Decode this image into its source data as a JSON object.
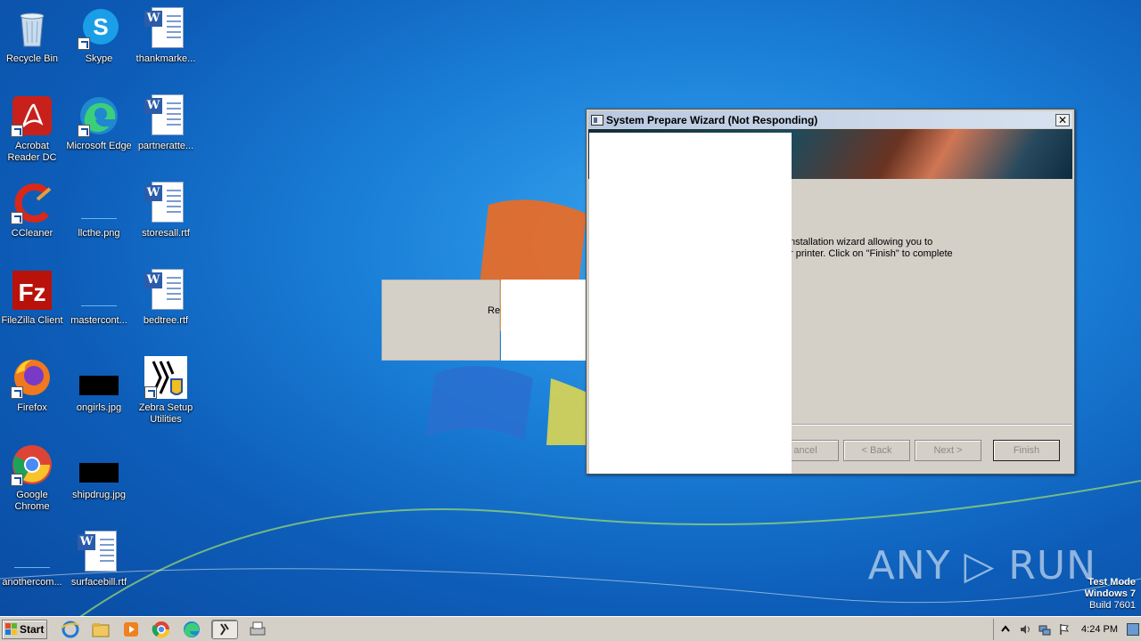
{
  "desktop": {
    "icons": [
      {
        "label": "Recycle Bin"
      },
      {
        "label": "Skype"
      },
      {
        "label": "thankmarke..."
      },
      {
        "label": "Acrobat Reader DC"
      },
      {
        "label": "Microsoft Edge"
      },
      {
        "label": "partneratte..."
      },
      {
        "label": "CCleaner"
      },
      {
        "label": "llcthe.png"
      },
      {
        "label": "storesall.rtf"
      },
      {
        "label": "FileZilla Client"
      },
      {
        "label": "mastercont..."
      },
      {
        "label": "bedtree.rtf"
      },
      {
        "label": "Firefox"
      },
      {
        "label": "ongirls.jpg"
      },
      {
        "label": "Zebra Setup Utilities"
      },
      {
        "label": "Google Chrome"
      },
      {
        "label": "shipdrug.jpg"
      },
      {
        "label": "anothercom..."
      },
      {
        "label": "surfacebill.rtf"
      }
    ]
  },
  "wizard": {
    "title": "System Prepare Wizard (Not Responding)",
    "close_label": "✕",
    "body_text": "nstallation wizard allowing you to\nr printer. Click on \"Finish\" to complete",
    "buttons": {
      "cancel": "ancel",
      "back": "< Back",
      "next": "Next >",
      "finish": "Finish"
    }
  },
  "ghost_window": {
    "text": "Re"
  },
  "watermark": {
    "text": "ANY ▷ RUN"
  },
  "test_mode": {
    "line1": "Test Mode",
    "line2": "Windows 7",
    "line3": "Build 7601"
  },
  "taskbar": {
    "start_label": "Start",
    "clock": "4:24 PM"
  }
}
